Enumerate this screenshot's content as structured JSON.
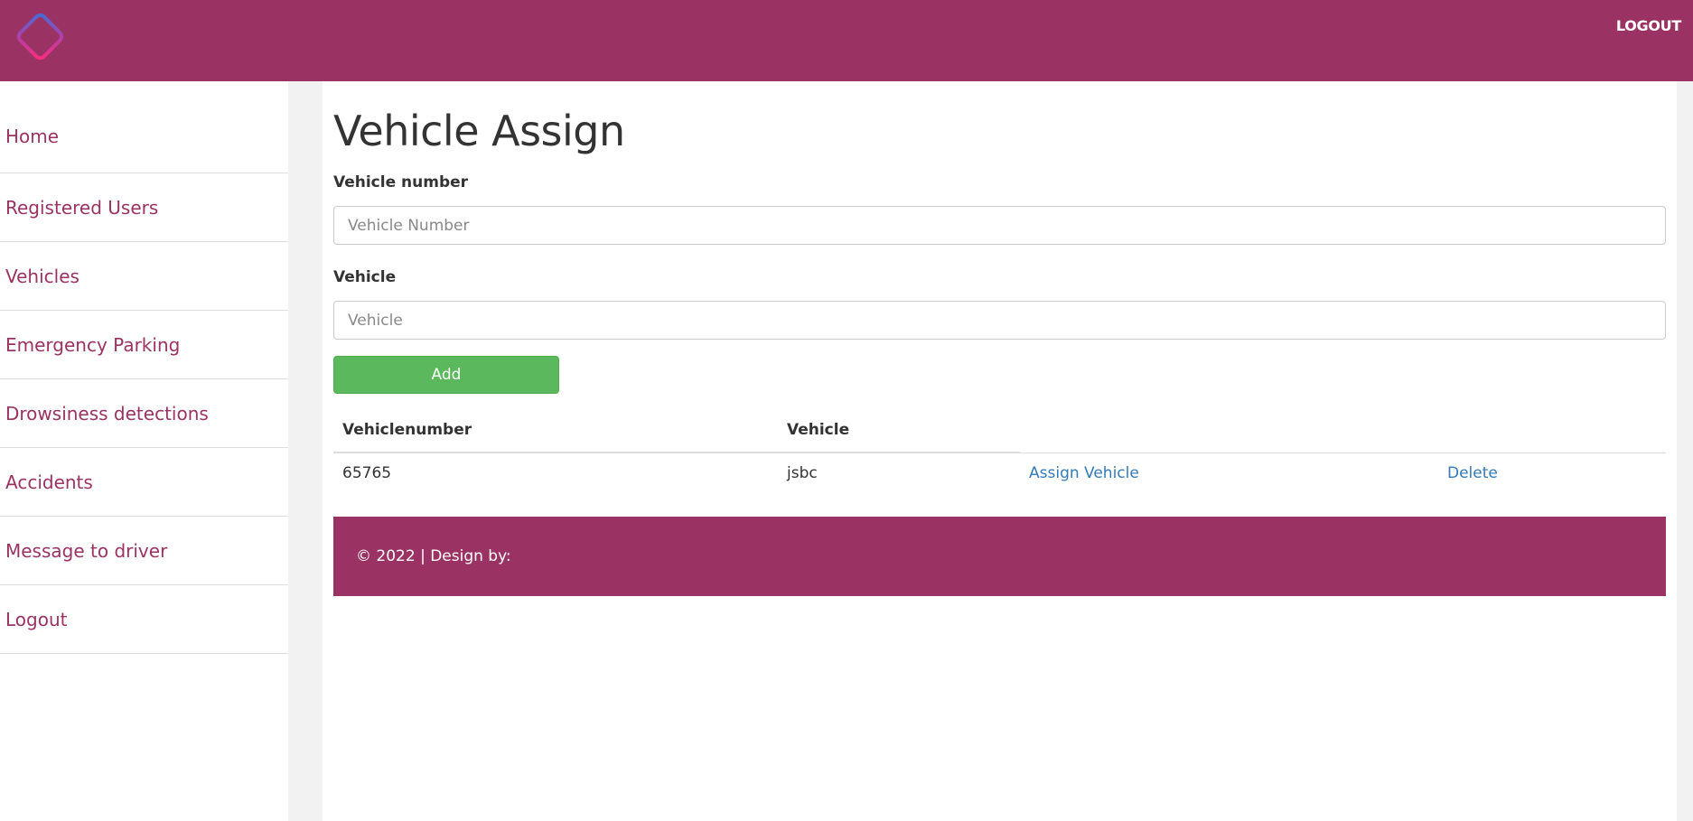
{
  "header": {
    "logout_label": "LOGOUT",
    "brand_color": "#9a3363"
  },
  "sidebar": {
    "items": [
      {
        "label": "Home"
      },
      {
        "label": "Registered Users"
      },
      {
        "label": "Vehicles"
      },
      {
        "label": "Emergency Parking"
      },
      {
        "label": "Drowsiness detections"
      },
      {
        "label": "Accidents"
      },
      {
        "label": "Message to driver"
      },
      {
        "label": "Logout"
      }
    ]
  },
  "main": {
    "title": "Vehicle Assign",
    "form": {
      "vehicle_number_label": "Vehicle number",
      "vehicle_number_placeholder": "Vehicle Number",
      "vehicle_number_value": "",
      "vehicle_label": "Vehicle",
      "vehicle_placeholder": "Vehicle",
      "vehicle_value": "",
      "add_label": "Add"
    },
    "table": {
      "headers": [
        "Vehiclenumber",
        "Vehicle"
      ],
      "rows": [
        {
          "vehiclenumber": "65765",
          "vehicle": "jsbc",
          "assign_label": "Assign Vehicle",
          "delete_label": "Delete"
        }
      ]
    },
    "footer": {
      "text": "© 2022 | Design by:"
    }
  },
  "colors": {
    "accent": "#9a3363",
    "success": "#5cb85c",
    "link": "#337ab7"
  }
}
